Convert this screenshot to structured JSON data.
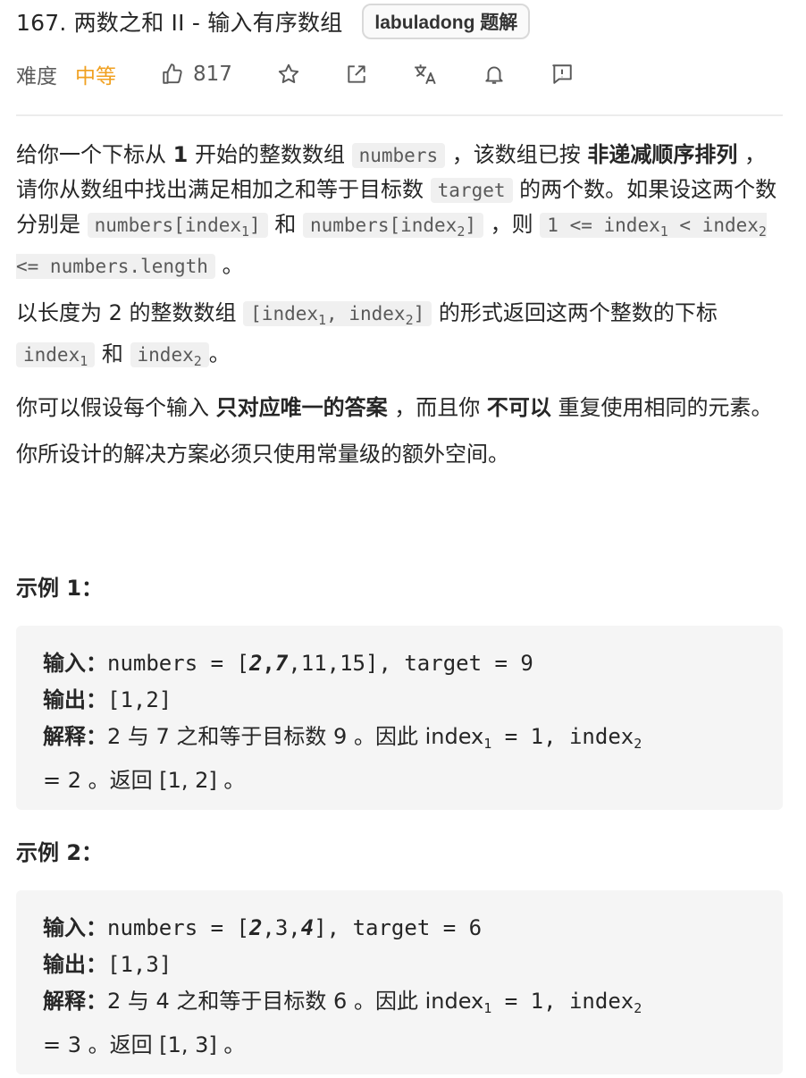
{
  "header": {
    "title": "167. 两数之和 II - 输入有序数组",
    "badge": "labuladong 题解"
  },
  "meta": {
    "difficulty_label": "难度",
    "difficulty_value": "中等",
    "like_count": "817",
    "icons": [
      "thumbs-up-icon",
      "star-icon",
      "share-icon",
      "translate-icon",
      "bell-icon",
      "feedback-icon"
    ]
  },
  "description": {
    "p1": {
      "t1": "给你一个下标从 ",
      "b1": "1",
      "t2": " 开始的整数数组 ",
      "c1": "numbers",
      "t3": " ，该数组已按 ",
      "b2": "非递减顺序排列",
      "t4": " ，请你从数组中找出满足相加之和等于目标数 ",
      "c2": "target",
      "t5": " 的两个数。如果设这两个数分别是 ",
      "c3a": "numbers[index",
      "c3s": "1",
      "c3b": "]",
      "t6": " 和 ",
      "c4a": "numbers[index",
      "c4s": "2",
      "c4b": "]",
      "t7": " ，则 ",
      "c5a": "1 <= index",
      "c5s1": "1",
      "c5b": " < index",
      "c5s2": "2",
      "c5c": " <= numbers.length",
      "t8": " 。"
    },
    "p2": {
      "t1": "以长度为 2 的整数数组 ",
      "c1a": "[index",
      "c1s1": "1",
      "c1b": ", index",
      "c1s2": "2",
      "c1c": "]",
      "t2": " 的形式返回这两个整数的下标 ",
      "c2a": "index",
      "c2s": "1",
      "t3": " 和 ",
      "c3a": "index",
      "c3s": "2",
      "t4": "。"
    },
    "p3": {
      "t1": "你可以假设每个输入 ",
      "b1": "只对应唯一的答案",
      "t2": " ，而且你 ",
      "b2": "不可以",
      "t3": " 重复使用相同的元素。"
    },
    "p4": "你所设计的解决方案必须只使用常量级的额外空间。"
  },
  "examples": [
    {
      "title": "示例 1：",
      "input_label": "输入：",
      "input_pre": "numbers = [",
      "input_b1": "2",
      "input_comma": ",",
      "input_b2": "7",
      "input_post": ",11,15], target = 9",
      "output_label": "输出：",
      "output_value": "[1,2]",
      "explain_label": "解释：",
      "explain_l1a": "2 与 7 之和等于目标数 9 。因此 index",
      "explain_s1": "1",
      "explain_l1b": " = 1, index",
      "explain_s2": "2",
      "explain_l2": "= 2 。返回 [1, 2] 。"
    },
    {
      "title": "示例 2：",
      "input_label": "输入：",
      "input_pre": "numbers = [",
      "input_b1": "2",
      "input_mid": ",3,",
      "input_b2": "4",
      "input_post": "], target = 6",
      "output_label": "输出：",
      "output_value": "[1,3]",
      "explain_label": "解释：",
      "explain_l1a": "2 与 4 之和等于目标数 6 。因此 index",
      "explain_s1": "1",
      "explain_l1b": " = 1, index",
      "explain_s2": "2",
      "explain_l2": "= 3 。返回 [1, 3] 。"
    }
  ]
}
